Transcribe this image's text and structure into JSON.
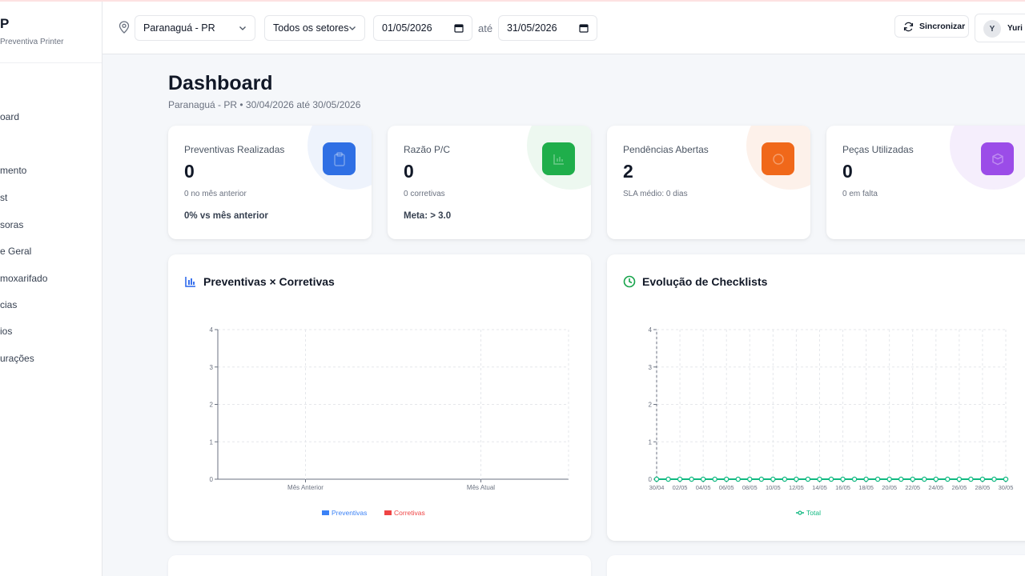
{
  "app": {
    "brand_letter": "P",
    "brand_sub": "Preventiva Printer"
  },
  "sidebar": {
    "items": [
      {
        "label": "oard"
      },
      {
        "label": "mento"
      },
      {
        "label": "st"
      },
      {
        "label": "soras"
      },
      {
        "label": "e Geral"
      },
      {
        "label": "moxarifado"
      },
      {
        "label": "cias"
      },
      {
        "label": "ios"
      },
      {
        "label": "urações"
      }
    ]
  },
  "header": {
    "location": "Paranaguá - PR",
    "sector": "Todos os setores",
    "date_from": "01/05/2026",
    "between": "até",
    "date_to": "31/05/2026",
    "sync_label": "Sincronizar",
    "user_initial": "Y",
    "user_name": "Yuri C"
  },
  "page": {
    "title": "Dashboard",
    "subtitle": "Paranaguá - PR • 30/04/2026 até 30/05/2026"
  },
  "cards": [
    {
      "label": "Preventivas Realizadas",
      "value": "0",
      "small": "0 no mês anterior",
      "foot": "0% vs mês anterior",
      "color": "#2563eb",
      "icon": "clipboard-icon"
    },
    {
      "label": "Razão P/C",
      "value": "0",
      "small": "0 corretivas",
      "foot": "Meta: > 3.0",
      "color": "#16a34a",
      "icon": "bar-chart-icon"
    },
    {
      "label": "Pendências Abertas",
      "value": "2",
      "small": "SLA médio: 0 dias",
      "foot": "",
      "color": "#ea580c",
      "icon": "alert-icon"
    },
    {
      "label": "Peças Utilizadas",
      "value": "0",
      "small": "0 em falta",
      "foot": "",
      "color": "#9333ea",
      "icon": "package-icon"
    }
  ],
  "panels": {
    "left_title": "Preventivas × Corretivas",
    "right_title": "Evolução de Checklists"
  },
  "chart_data": [
    {
      "type": "bar",
      "categories": [
        "Mês Anterior",
        "Mês Atual"
      ],
      "series": [
        {
          "name": "Preventivas",
          "values": [
            0,
            0
          ],
          "color": "#3b82f6"
        },
        {
          "name": "Corretivas",
          "values": [
            0,
            0
          ],
          "color": "#ef4444"
        }
      ],
      "ylim": [
        0,
        4
      ],
      "yticks": [
        "0",
        "1",
        "2",
        "3",
        "4"
      ],
      "grid": true,
      "legend": "bottom"
    },
    {
      "type": "line",
      "x": [
        "30/04",
        "01/05",
        "02/05",
        "03/05",
        "04/05",
        "05/05",
        "06/05",
        "07/05",
        "08/05",
        "09/05",
        "10/05",
        "11/05",
        "12/05",
        "13/05",
        "14/05",
        "15/05",
        "16/05",
        "17/05",
        "18/05",
        "19/05",
        "20/05",
        "21/05",
        "22/05",
        "23/05",
        "24/05",
        "25/05",
        "26/05",
        "27/05",
        "28/05",
        "29/05",
        "30/05"
      ],
      "xtick_labels": [
        "30/04",
        "02/05",
        "04/05",
        "06/05",
        "08/05",
        "10/05",
        "12/05",
        "14/05",
        "16/05",
        "18/05",
        "20/05",
        "22/05",
        "24/05",
        "26/05",
        "28/05",
        "30/05"
      ],
      "series": [
        {
          "name": "Total",
          "values": [
            0,
            0,
            0,
            0,
            0,
            0,
            0,
            0,
            0,
            0,
            0,
            0,
            0,
            0,
            0,
            0,
            0,
            0,
            0,
            0,
            0,
            0,
            0,
            0,
            0,
            0,
            0,
            0,
            0,
            0,
            0
          ],
          "color": "#10b981"
        }
      ],
      "ylim": [
        0,
        4
      ],
      "yticks": [
        "0",
        "1",
        "2",
        "3",
        "4"
      ],
      "grid": true,
      "legend": "bottom"
    }
  ]
}
